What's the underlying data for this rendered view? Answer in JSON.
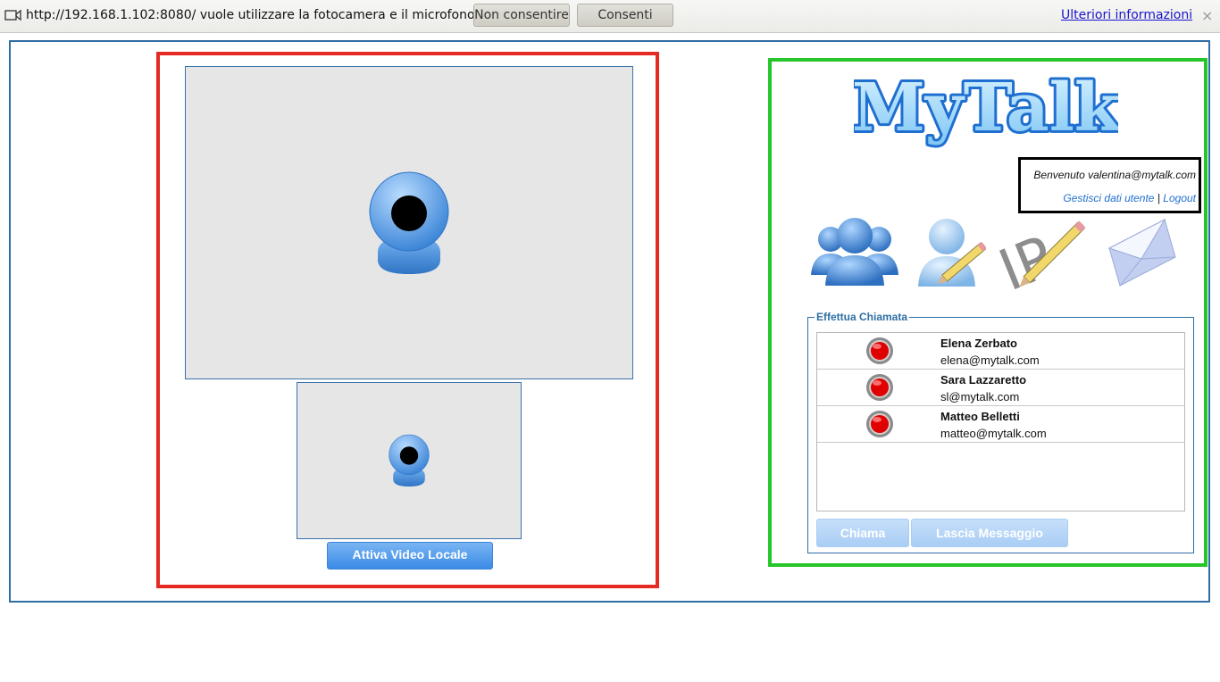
{
  "notification": {
    "message": "http://192.168.1.102:8080/ vuole utilizzare la fotocamera e il microfono.",
    "deny_label": "Non consentire",
    "allow_label": "Consenti",
    "more_info_label": "Ulteriori informazioni",
    "close_label": "×"
  },
  "video": {
    "activate_label": "Attiva Video Locale"
  },
  "logo": {
    "text": "MyTalk"
  },
  "user": {
    "welcome": "Benvenuto valentina@mytalk.com",
    "manage_label": "Gestisci dati utente",
    "separator": "|",
    "logout_label": "Logout"
  },
  "toolbar_icons": [
    "contacts-icon",
    "edit-user-icon",
    "ip-edit-icon",
    "messages-icon"
  ],
  "call_panel": {
    "legend": "Effettua Chiamata",
    "contacts": [
      {
        "name": "Elena Zerbato",
        "email": "elena@mytalk.com",
        "status": "offline"
      },
      {
        "name": "Sara Lazzaretto",
        "email": "sl@mytalk.com",
        "status": "offline"
      },
      {
        "name": "Matteo Belletti",
        "email": "matteo@mytalk.com",
        "status": "offline"
      }
    ],
    "call_label": "Chiama",
    "message_label": "Lascia Messaggio"
  },
  "colors": {
    "frame_border": "#2f6ea3",
    "video_panel_outline": "#e42a22",
    "user_panel_outline": "#26c62b",
    "button_blue": "#3a8ae6",
    "status_offline": "#e00000"
  }
}
